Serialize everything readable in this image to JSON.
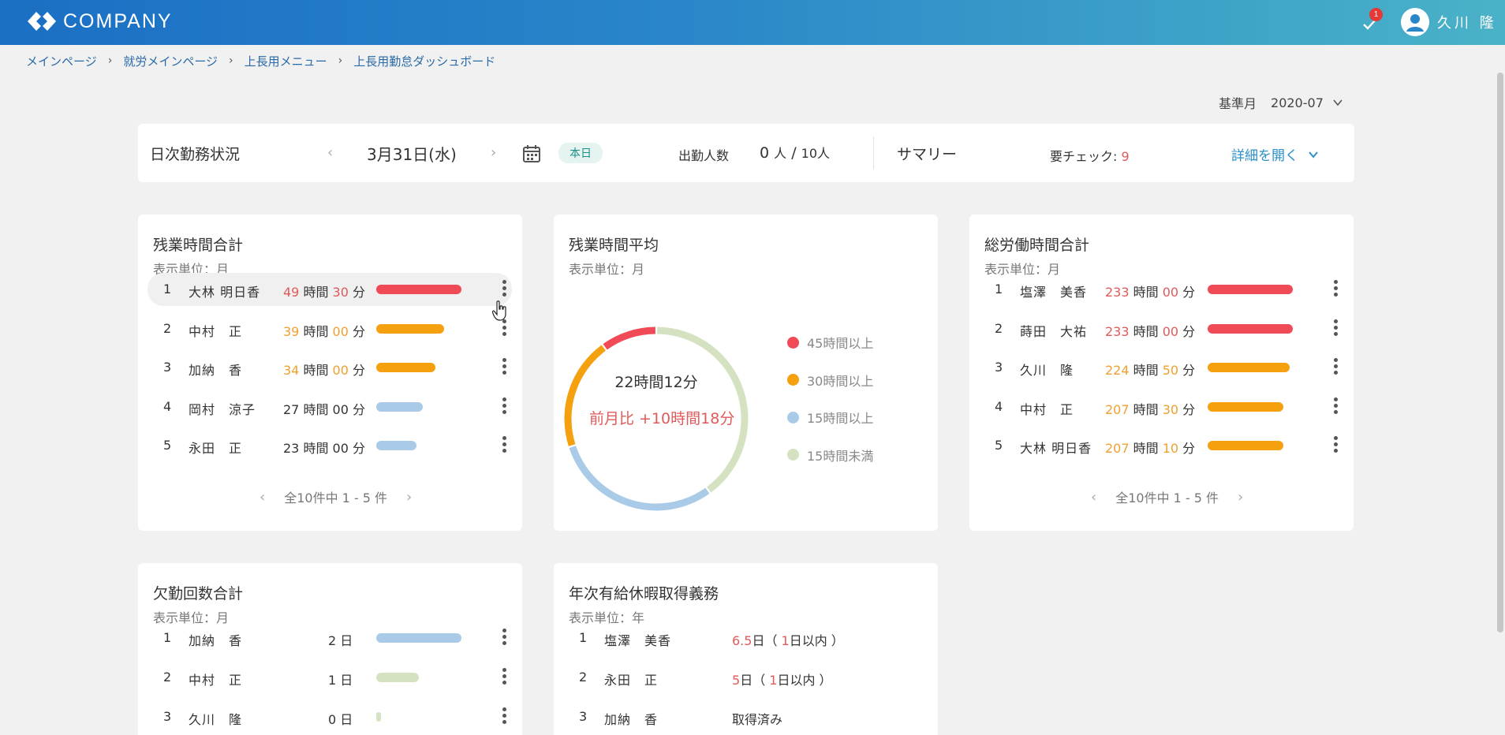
{
  "header": {
    "logo_text": "COMPANY",
    "notification_count": "1",
    "user_name": "久川 隆"
  },
  "breadcrumb": [
    "メインページ",
    "就労メインページ",
    "上長用メニュー",
    "上長用勤怠ダッシュボード"
  ],
  "base_month": {
    "label": "基準月",
    "value": "2020-07"
  },
  "daily_status": {
    "title": "日次勤務状況",
    "date": "3月31日(水)",
    "today_label": "本日",
    "attendance_label": "出勤人数",
    "attendance_present": "0",
    "attendance_unit": "人",
    "attendance_total": "10",
    "summary_label": "サマリー",
    "check_label": "要チェック:",
    "check_count": "9",
    "detail_label": "詳細を開く"
  },
  "colors": {
    "red": "#f04a57",
    "orange": "#f5a00f",
    "blue": "#a9cbe8",
    "green": "#d5e2c2"
  },
  "overtime_total": {
    "title": "残業時間合計",
    "unit_label": "表示単位：月",
    "rows": [
      {
        "rank": "1",
        "name": "大林 明日香",
        "hours": "49",
        "minutes": "30",
        "level": "red",
        "fill": 1.0
      },
      {
        "rank": "2",
        "name": "中村　正",
        "hours": "39",
        "minutes": "00",
        "level": "orange",
        "fill": 0.8
      },
      {
        "rank": "3",
        "name": "加納　香",
        "hours": "34",
        "minutes": "00",
        "level": "orange",
        "fill": 0.69
      },
      {
        "rank": "4",
        "name": "岡村　涼子",
        "hours": "27",
        "minutes": "00",
        "level": "blue",
        "fill": 0.55
      },
      {
        "rank": "5",
        "name": "永田　正",
        "hours": "23",
        "minutes": "00",
        "level": "blue",
        "fill": 0.47
      }
    ],
    "time_labels": {
      "hour": "時間",
      "minute": "分"
    },
    "pager": "全10件中 1 - 5 件"
  },
  "overtime_avg": {
    "title": "残業時間平均",
    "unit_label": "表示単位：月",
    "center_value": "22時間12分",
    "compare": "前月比 +10時間18分",
    "segments": [
      {
        "label": "45時間以上",
        "color": "red",
        "value": 10
      },
      {
        "label": "30時間以上",
        "color": "orange",
        "value": 20
      },
      {
        "label": "15時間以上",
        "color": "blue",
        "value": 30
      },
      {
        "label": "15時間未満",
        "color": "green",
        "value": 40
      }
    ]
  },
  "total_work": {
    "title": "総労働時間合計",
    "unit_label": "表示単位：月",
    "rows": [
      {
        "rank": "1",
        "name": "塩澤　美香",
        "hours": "233",
        "minutes": "00",
        "level": "red",
        "fill": 1.0
      },
      {
        "rank": "2",
        "name": "蒔田　大祐",
        "hours": "233",
        "minutes": "00",
        "level": "red",
        "fill": 1.0
      },
      {
        "rank": "3",
        "name": "久川　隆",
        "hours": "224",
        "minutes": "50",
        "level": "orange",
        "fill": 0.96
      },
      {
        "rank": "4",
        "name": "中村　正",
        "hours": "207",
        "minutes": "30",
        "level": "orange",
        "fill": 0.89
      },
      {
        "rank": "5",
        "name": "大林 明日香",
        "hours": "207",
        "minutes": "10",
        "level": "orange",
        "fill": 0.89
      }
    ],
    "pager": "全10件中 1 - 5 件"
  },
  "absence_total": {
    "title": "欠勤回数合計",
    "unit_label": "表示単位：月",
    "rows": [
      {
        "rank": "1",
        "name": "加納　香",
        "value": "2",
        "unit": "日",
        "level": "blue",
        "fill": 1.0
      },
      {
        "rank": "2",
        "name": "中村　正",
        "value": "1",
        "unit": "日",
        "level": "green",
        "fill": 0.5
      },
      {
        "rank": "3",
        "name": "久川　隆",
        "value": "0",
        "unit": "日",
        "level": "green",
        "fill": 0.02
      }
    ]
  },
  "paid_leave": {
    "title": "年次有給休暇取得義務",
    "unit_label": "表示単位：年",
    "rows": [
      {
        "rank": "1",
        "name": "塩澤　美香",
        "days": "6.5",
        "within": "1"
      },
      {
        "rank": "2",
        "name": "永田　正",
        "days": "5",
        "within": "1"
      },
      {
        "rank": "3",
        "name": "加納　香",
        "status": "取得済み"
      }
    ],
    "day_unit": "日",
    "within_suffix": "日以内"
  }
}
